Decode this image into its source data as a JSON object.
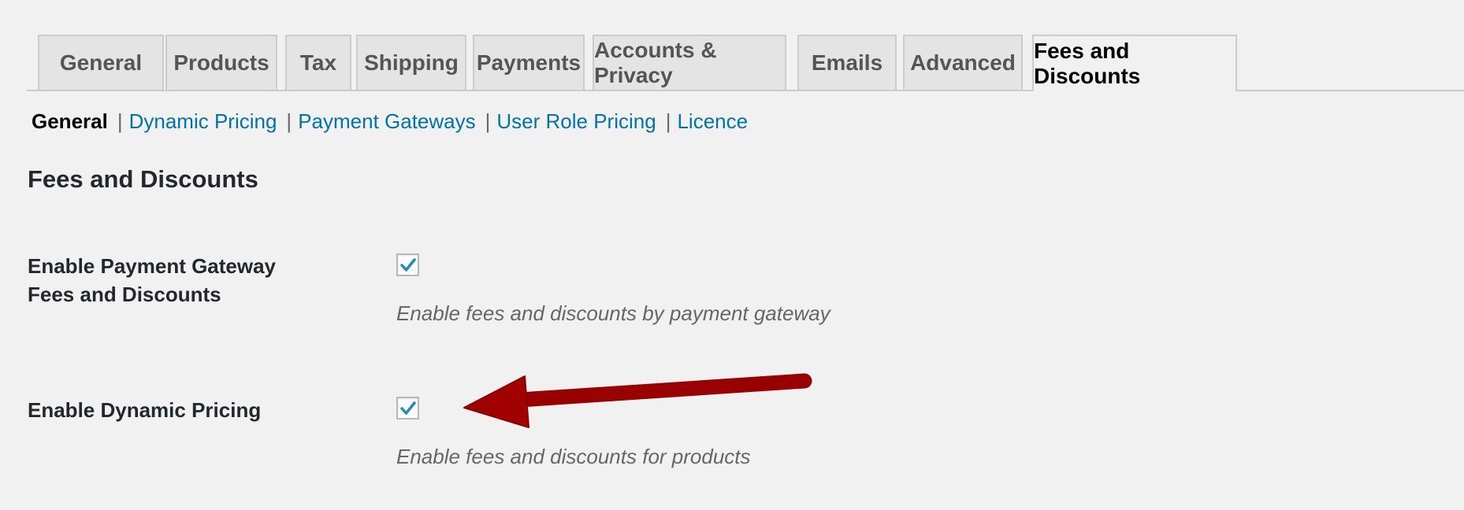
{
  "tabs": [
    {
      "label": "General",
      "active": false
    },
    {
      "label": "Products",
      "active": false
    },
    {
      "label": "Tax",
      "active": false
    },
    {
      "label": "Shipping",
      "active": false
    },
    {
      "label": "Payments",
      "active": false
    },
    {
      "label": "Accounts & Privacy",
      "active": false
    },
    {
      "label": "Emails",
      "active": false
    },
    {
      "label": "Advanced",
      "active": false
    },
    {
      "label": "Fees and Discounts",
      "active": true
    }
  ],
  "subnav": {
    "current": "General",
    "separator": "|",
    "links": [
      "Dynamic Pricing",
      "Payment Gateways",
      "User Role Pricing",
      "Licence"
    ]
  },
  "section_title": "Fees and Discounts",
  "settings": [
    {
      "label_line1": "Enable Payment Gateway",
      "label_line2": "Fees and Discounts",
      "checked": true,
      "description": "Enable fees and discounts by payment gateway"
    },
    {
      "label_line1": "Enable Dynamic Pricing",
      "checked": true,
      "description": "Enable fees and discounts for products"
    }
  ],
  "annotation": {
    "type": "arrow",
    "points_to": "Enable Dynamic Pricing checkbox",
    "color": "#990000"
  },
  "colors": {
    "link": "#0073aa",
    "checkmark": "#1e8cbe",
    "background": "#f1f1f1",
    "tab_inactive": "#e4e4e4"
  }
}
